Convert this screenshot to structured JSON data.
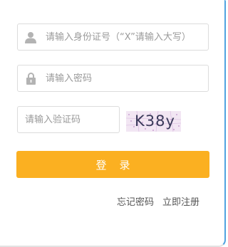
{
  "form": {
    "id_number": {
      "placeholder": "请输入身份证号（“X”请输入大写）",
      "icon": "user-icon"
    },
    "password": {
      "placeholder": "请输入密码",
      "icon": "lock-icon"
    },
    "captcha": {
      "placeholder": "请输入验证码",
      "image_text": "K38y"
    },
    "login_label": "登录"
  },
  "links": {
    "forgot_password": "忘记密码",
    "register": "立即注册"
  },
  "colors": {
    "primary_button": "#fbb021",
    "border": "#dcdcdc",
    "icon": "#b3b3b3",
    "panel_edge": "#4fa3e0"
  }
}
